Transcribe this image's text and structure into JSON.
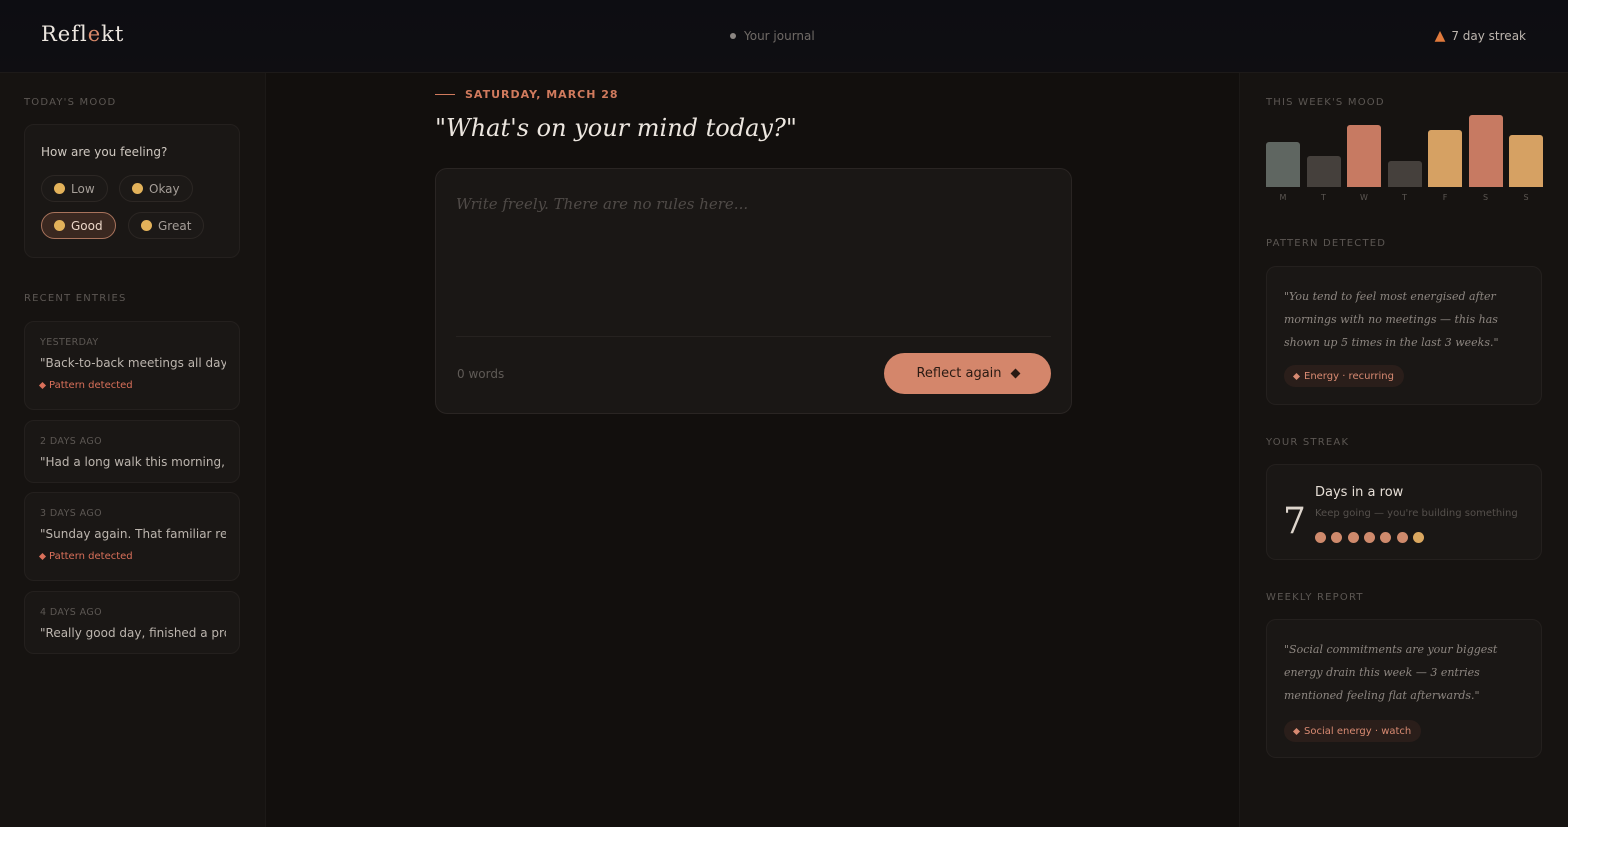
{
  "header": {
    "logo_pre": "Refl",
    "logo_accent": "e",
    "logo_post": "kt",
    "nav_label": "Your journal",
    "streak_label": "7 day streak",
    "streak_icon": "flame-icon"
  },
  "left": {
    "mood_section": "TODAY'S MOOD",
    "mood_question": "How are you feeling?",
    "moods": [
      {
        "label": "Low",
        "icon": "emoji-icon"
      },
      {
        "label": "Okay",
        "icon": "emoji-icon"
      },
      {
        "label": "Good",
        "icon": "emoji-icon",
        "selected": true
      },
      {
        "label": "Great",
        "icon": "emoji-icon"
      }
    ],
    "recent_section": "RECENT ENTRIES",
    "entries": [
      {
        "date": "YESTERDAY",
        "text": "\"Back-to-back meetings all day,...",
        "tag": "Pattern detected"
      },
      {
        "date": "2 DAYS AGO",
        "text": "\"Had a long walk this morning, e..."
      },
      {
        "date": "3 DAYS AGO",
        "text": "\"Sunday again. That familiar rest...",
        "tag": "Pattern detected"
      },
      {
        "date": "4 DAYS AGO",
        "text": "\"Really good day, finished a proj..."
      }
    ]
  },
  "center": {
    "date": "SATURDAY, MARCH 28",
    "prompt": "\"What's on your mind today?\"",
    "editor_placeholder": "Write freely. There are no rules here...",
    "editor_value": "",
    "word_count": "0 words",
    "reflect_button": "Reflect again"
  },
  "right": {
    "week_section": "THIS WEEK'S MOOD",
    "week_chart": {
      "days": [
        "M",
        "T",
        "W",
        "T",
        "F",
        "S",
        "S"
      ],
      "levels": [
        0.63,
        0.43,
        0.86,
        0.36,
        0.79,
        1.0,
        0.72
      ],
      "colors": [
        "#5f6661",
        "#45403c",
        "#c77a62",
        "#45403c",
        "#d6a163",
        "#c77a62",
        "#d6a163"
      ]
    },
    "pattern_section": "PATTERN DETECTED",
    "pattern_quote": "\"You tend to feel most energised after mornings with no meetings — this has shown up 5 times in the last 3 weeks.\"",
    "pattern_tag": "Energy · recurring",
    "streak_section": "YOUR STREAK",
    "streak_count": "7",
    "streak_title": "Days in a row",
    "streak_sub": "Keep going — you're building something",
    "streak_days": 7,
    "report_section": "WEEKLY REPORT",
    "report_quote": "\"Social commitments are your biggest energy drain this week — 3 entries mentioned feeling flat afterwards.\"",
    "report_tag": "Social energy · watch"
  },
  "colors": {
    "accent": "#d4866b",
    "background": "#120f0d",
    "panel": "#161311"
  }
}
